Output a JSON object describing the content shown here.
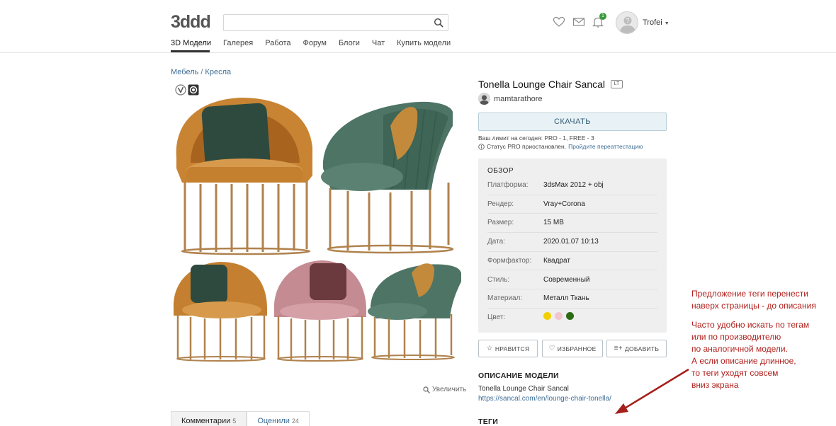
{
  "header": {
    "logo_text": "3ddd",
    "search_placeholder": "",
    "notification_count": "1",
    "username": "Trofei",
    "nav": [
      {
        "label": "3D Модели",
        "active": true
      },
      {
        "label": "Галерея"
      },
      {
        "label": "Работа"
      },
      {
        "label": "Форум"
      },
      {
        "label": "Блоги"
      },
      {
        "label": "Чат"
      },
      {
        "label": "Купить модели"
      }
    ]
  },
  "breadcrumb": [
    "Мебель",
    "Кресла"
  ],
  "product": {
    "title": "Tonella Lounge Chair Sancal",
    "badge": "LT",
    "author": "mamtarathore",
    "download_label": "СКАЧАТЬ",
    "limit_text": "Ваш лимит на сегодня: PRO - 1, FREE - 3",
    "status_text": "Статус PRO приостановлен.",
    "status_link": "Пройдите переаттестацию",
    "zoom_label": "Увеличить"
  },
  "overview": {
    "heading": "ОБЗОР",
    "rows": [
      {
        "label": "Платформа:",
        "value": "3dsMax 2012 + obj"
      },
      {
        "label": "Рендер:",
        "value": "Vray+Corona"
      },
      {
        "label": "Размер:",
        "value": "15 MB"
      },
      {
        "label": "Дата:",
        "value": "2020.01.07 10:13"
      },
      {
        "label": "Формфактор:",
        "value": "Квадрат"
      },
      {
        "label": "Стиль:",
        "value": "Современный"
      },
      {
        "label": "Материал:",
        "value": "Металл Ткань"
      },
      {
        "label": "Цвет:",
        "value": ""
      }
    ],
    "colors": [
      "#f2d000",
      "#f2c6cf",
      "#2e6b14"
    ]
  },
  "actions": {
    "like": "НРАВИТСЯ",
    "favorite": "ИЗБРАННОЕ",
    "add": "ДОБАВИТЬ"
  },
  "description": {
    "heading": "ОПИСАНИЕ МОДЕЛИ",
    "text": "Tonella Lounge Chair Sancal",
    "link": "https://sancal.com/en/lounge-chair-tonella/",
    "tags_heading": "ТЕГИ"
  },
  "tabs": [
    {
      "label": "Комментарии",
      "count": "5"
    },
    {
      "label": "Оценили",
      "count": "24"
    }
  ],
  "annotation": {
    "lines_top": [
      "Предложение теги перенести",
      "наверх страницы - до описания"
    ],
    "lines_bottom": [
      "Часто удобно искать по тегам",
      "или по производителю",
      "по аналогичной модели.",
      "А если описание длинное,",
      "то теги уходят совсем",
      "вниз экрана"
    ]
  }
}
